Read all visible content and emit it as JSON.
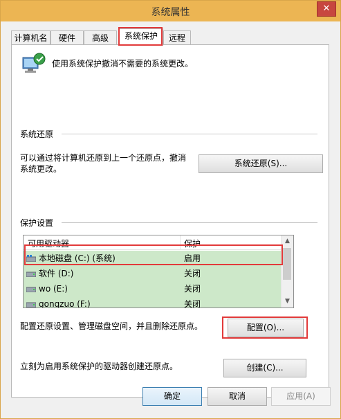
{
  "window": {
    "title": "系统属性",
    "close_label": "✕"
  },
  "tabs": [
    {
      "label": "计算机名",
      "active": false
    },
    {
      "label": "硬件",
      "active": false
    },
    {
      "label": "高级",
      "active": false
    },
    {
      "label": "系统保护",
      "active": true
    },
    {
      "label": "远程",
      "active": false
    }
  ],
  "intro": {
    "icon": "system-protection-icon",
    "text": "使用系统保护撤消不需要的系统更改。"
  },
  "restore": {
    "section_label": "系统还原",
    "description": "可以通过将计算机还原到上一个还原点，撤消系统更改。",
    "button_label": "系统还原(S)..."
  },
  "protection": {
    "section_label": "保护设置",
    "columns": [
      "可用驱动器",
      "保护"
    ],
    "drives": [
      {
        "name": "本地磁盘 (C:) (系统)",
        "protection": "启用",
        "icon": "system-drive-icon"
      },
      {
        "name": "软件 (D:)",
        "protection": "关闭",
        "icon": "drive-icon"
      },
      {
        "name": "wo (E:)",
        "protection": "关闭",
        "icon": "drive-icon"
      },
      {
        "name": "gongzuo (F:)",
        "protection": "关闭",
        "icon": "drive-icon"
      }
    ],
    "configure_text": "配置还原设置、管理磁盘空间，并且删除还原点。",
    "configure_button": "配置(O)...",
    "create_text": "立刻为启用系统保护的驱动器创建还原点。",
    "create_button": "创建(C)..."
  },
  "footer": {
    "ok": "确定",
    "cancel": "取消",
    "apply": "应用(A)"
  },
  "colors": {
    "title_bar": "#ecb553",
    "highlight": "#e23a3a",
    "row_selected": "#cde8c9"
  }
}
